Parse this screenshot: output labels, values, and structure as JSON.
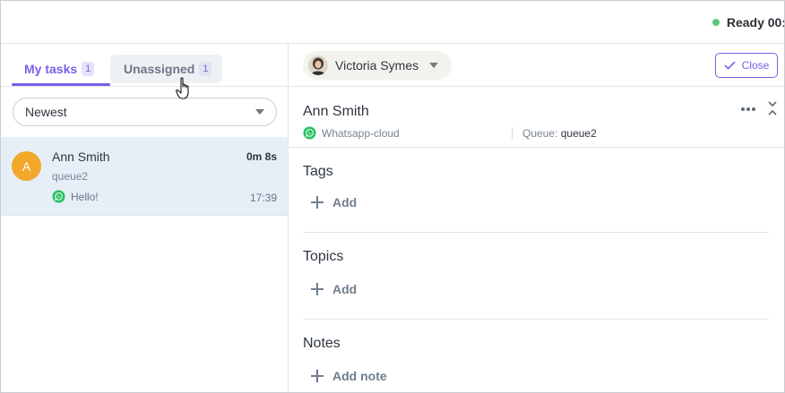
{
  "status": {
    "label": "Ready 00:",
    "color": "#5cc77a"
  },
  "tabs": [
    {
      "label": "My tasks",
      "count": "1",
      "active": true
    },
    {
      "label": "Unassigned",
      "count": "1",
      "active": false
    }
  ],
  "sort": {
    "selected": "Newest"
  },
  "tasks": [
    {
      "avatar_letter": "A",
      "avatar_color": "#f2a82a",
      "name": "Ann Smith",
      "elapsed": "0m 8s",
      "queue": "queue2",
      "last_message": "Hello!",
      "time": "17:39",
      "channel_icon": "whatsapp-icon"
    }
  ],
  "agent": {
    "name": "Victoria Symes"
  },
  "close_button": {
    "label": "Close"
  },
  "contact": {
    "name": "Ann Smith",
    "channel": "Whatsapp-cloud",
    "queue_label": "Queue:",
    "queue_value": "queue2"
  },
  "sections": {
    "tags": {
      "title": "Tags",
      "add_label": "Add"
    },
    "topics": {
      "title": "Topics",
      "add_label": "Add"
    },
    "notes": {
      "title": "Notes",
      "add_label": "Add note"
    }
  },
  "colors": {
    "accent": "#7c5ee8",
    "selected_row": "#e6eef7",
    "whatsapp": "#25c163"
  }
}
